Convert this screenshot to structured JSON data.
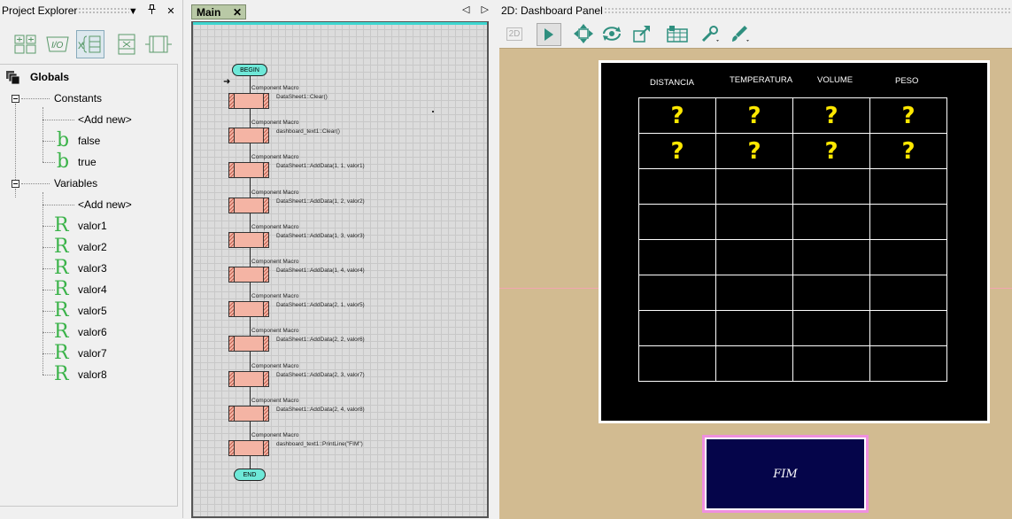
{
  "project_explorer": {
    "title": "Project Explorer",
    "pin_icon": "pin-icon",
    "close_icon": "close-icon",
    "tree": {
      "globals_label": "Globals",
      "constants_label": "Constants",
      "constants": [
        {
          "label": "<Add new>",
          "type": "add"
        },
        {
          "label": "false",
          "type": "bool"
        },
        {
          "label": "true",
          "type": "bool"
        }
      ],
      "variables_label": "Variables",
      "variables": [
        {
          "label": "<Add new>",
          "type": "add"
        },
        {
          "label": "valor1",
          "type": "real"
        },
        {
          "label": "valor2",
          "type": "real"
        },
        {
          "label": "valor3",
          "type": "real"
        },
        {
          "label": "valor4",
          "type": "real"
        },
        {
          "label": "valor5",
          "type": "real"
        },
        {
          "label": "valor6",
          "type": "real"
        },
        {
          "label": "valor7",
          "type": "real"
        },
        {
          "label": "valor8",
          "type": "real"
        }
      ],
      "bool_glyph": "b",
      "real_glyph": "R"
    }
  },
  "main": {
    "tab_label": "Main",
    "tab_close": "✕",
    "nav_left": "◁",
    "nav_right": "▷",
    "begin_label": "BEGIN",
    "end_label": "END",
    "macro_caption": "Component Macro",
    "macros": [
      "DataSheet1::Clear()",
      "dashboard_text1::Clear()",
      "DataSheet1::AddData(1, 1, valor1)",
      "DataSheet1::AddData(1, 2, valor2)",
      "DataSheet1::AddData(1, 3, valor3)",
      "DataSheet1::AddData(1, 4, valor4)",
      "DataSheet1::AddData(2, 1, valor5)",
      "DataSheet1::AddData(2, 2, valor6)",
      "DataSheet1::AddData(2, 3, valor7)",
      "DataSheet1::AddData(2, 4, valor8)",
      "dashboard_text1::PrintLine(\"FIM\")"
    ]
  },
  "dashboard": {
    "title": "2D: Dashboard Panel",
    "toolbar_2d_label": "2D",
    "column_headers": [
      "DISTANCIA",
      "TEMPERATURA",
      "VOLUME",
      "PESO"
    ],
    "cells": [
      [
        "?",
        "?",
        "?",
        "?"
      ],
      [
        "?",
        "?",
        "?",
        "?"
      ],
      [
        "",
        "",
        "",
        ""
      ],
      [
        "",
        "",
        "",
        ""
      ],
      [
        "",
        "",
        "",
        ""
      ],
      [
        "",
        "",
        "",
        ""
      ],
      [
        "",
        "",
        "",
        ""
      ],
      [
        "",
        "",
        "",
        ""
      ]
    ],
    "text_display": "FIM",
    "colors": {
      "background": "#d2bb91",
      "panel": "#000000",
      "cell_value": "#ffe800",
      "text_box": "#05054a",
      "text_box_border": "#ef8fe0"
    }
  }
}
